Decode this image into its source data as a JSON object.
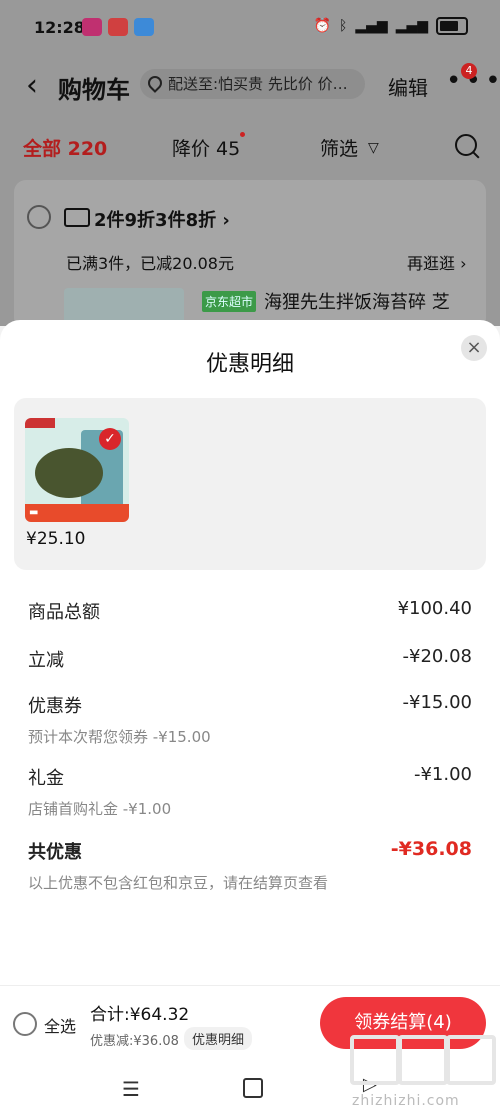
{
  "status_bar": {
    "time": "12:28"
  },
  "header": {
    "back_icon": "‹",
    "title": "购物车",
    "address": "配送至:怕买贵 先比价 价…",
    "edit_label": "编辑",
    "more_badge": "4"
  },
  "filters": {
    "all": "全部 220",
    "price_drop": "降价 45",
    "filter": "筛选"
  },
  "store_card": {
    "promo": "2件9折3件8折 ›",
    "status": "已满3件，已减20.08元",
    "more": "再逛逛 ›",
    "jd_tag": "京东超市",
    "product_name": "海狸先生拌饭海苔碎 芝"
  },
  "sheet": {
    "title": "优惠明细",
    "close_icon": "×",
    "product_price": "¥25.10",
    "rows": [
      {
        "label": "商品总额",
        "value": "¥100.40"
      },
      {
        "label": "立减",
        "value": "-¥20.08"
      },
      {
        "label": "优惠券",
        "value": "-¥15.00",
        "sub": "预计本次帮您领券 -¥15.00"
      },
      {
        "label": "礼金",
        "value": "-¥1.00",
        "sub": "店铺首购礼金 -¥1.00"
      },
      {
        "label": "共优惠",
        "value": "-¥36.08"
      }
    ],
    "note": "以上优惠不包含红包和京豆，请在结算页查看"
  },
  "bottom_bar": {
    "select_all": "全选",
    "total": "合计:¥64.32",
    "discount": "优惠减:¥36.08",
    "detail": "优惠明细",
    "checkout": "领券结算(4)"
  },
  "watermark": {
    "text": "zhizhizhi.com"
  },
  "colors": {
    "accent": "#f0363d",
    "discount_red": "#e02a22"
  }
}
